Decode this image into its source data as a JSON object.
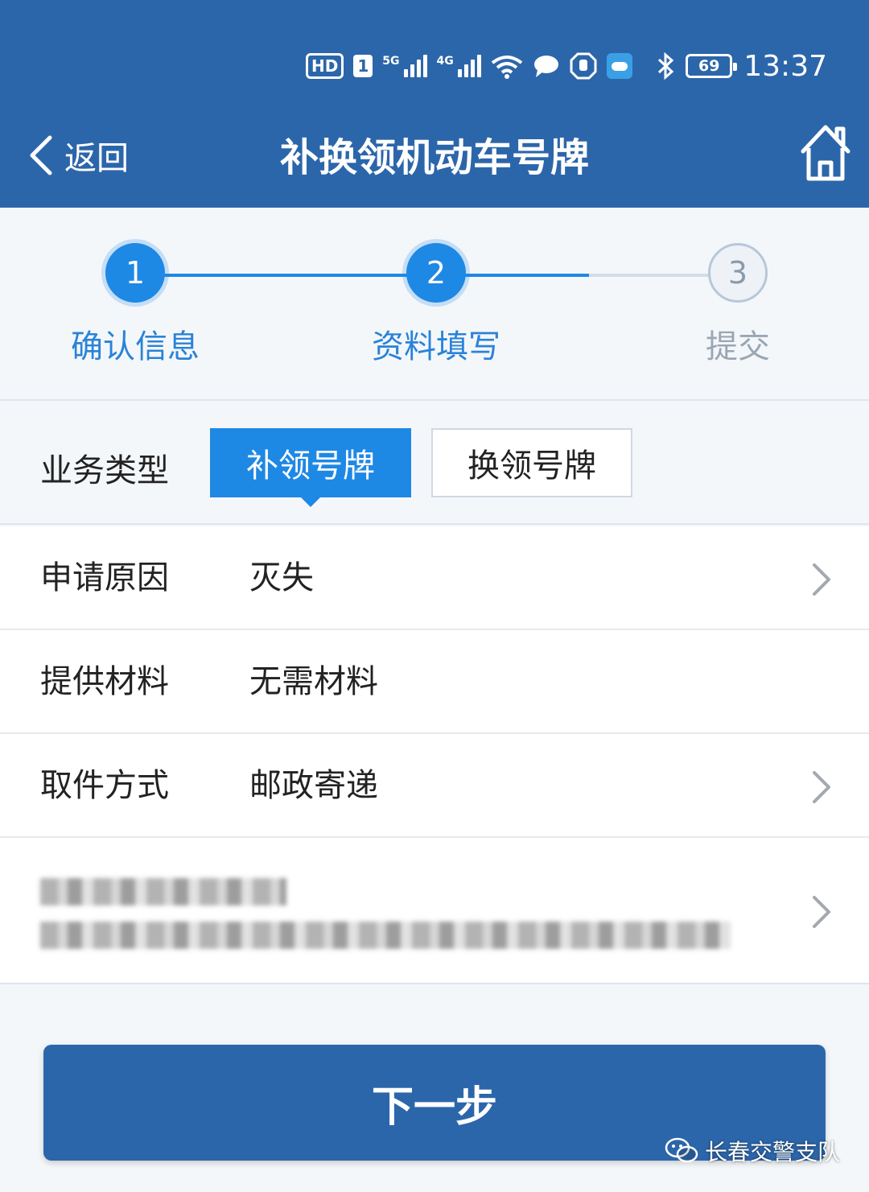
{
  "status_bar": {
    "hd": "HD",
    "sim": "1",
    "net1": "5G",
    "net2": "4G",
    "battery": "69",
    "time": "13:37"
  },
  "header": {
    "back_label": "返回",
    "title": "补换领机动车号牌"
  },
  "steps": [
    {
      "number": "1",
      "label": "确认信息",
      "state": "done"
    },
    {
      "number": "2",
      "label": "资料填写",
      "state": "current"
    },
    {
      "number": "3",
      "label": "提交",
      "state": "todo"
    }
  ],
  "business_type": {
    "label": "业务类型",
    "options": [
      "补领号牌",
      "换领号牌"
    ],
    "selected": "补领号牌"
  },
  "rows": [
    {
      "label": "申请原因",
      "value": "灭失"
    },
    {
      "label": "提供材料",
      "value": "无需材料"
    },
    {
      "label": "取件方式",
      "value": "邮政寄递"
    }
  ],
  "next_button": "下一步",
  "watermark": "长春交警支队",
  "colors": {
    "header_bg": "#2c66aa",
    "accent": "#1e88e5",
    "page_bg": "#f4f7fa"
  }
}
